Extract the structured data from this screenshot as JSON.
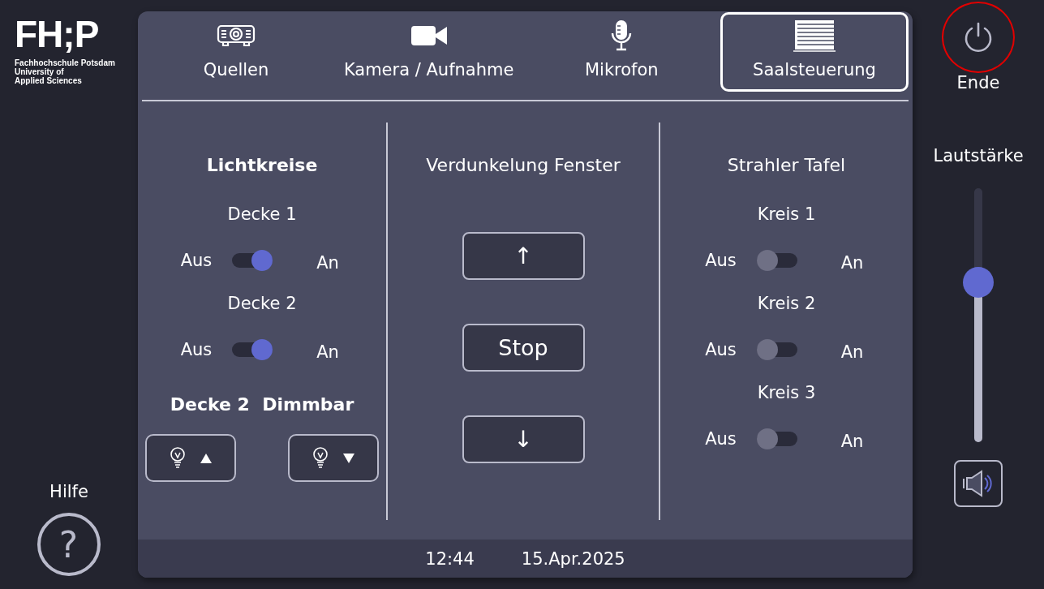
{
  "logo": {
    "wordmark": "FH;P",
    "lines": [
      "Fachhochschule Potsdam",
      "University of",
      "Applied Sciences"
    ]
  },
  "help": {
    "label": "Hilfe",
    "symbol": "?"
  },
  "tabs": [
    {
      "kind": "projector",
      "label": "Quellen",
      "selected": false
    },
    {
      "kind": "camera",
      "label": "Kamera / Aufnahme",
      "selected": false
    },
    {
      "kind": "microphone",
      "label": "Mikrofon",
      "selected": false
    },
    {
      "kind": "blinds",
      "label": "Saalsteuerung",
      "selected": true
    }
  ],
  "sections": [
    {
      "kind": "lights",
      "title": "Lichtkreise",
      "switches": [
        {
          "label": "Decke 1",
          "off_label": "Aus",
          "on_label": "An",
          "on": true
        },
        {
          "label": "Decke 2",
          "off_label": "Aus",
          "on_label": "An",
          "on": true
        }
      ],
      "dimmer": {
        "title": "Decke 2  Dimmbar",
        "buttons": [
          {
            "kind": "up"
          },
          {
            "kind": "down"
          }
        ]
      }
    },
    {
      "kind": "blinds",
      "title": "Verdunkelung Fenster",
      "buttons": [
        {
          "kind": "arrow",
          "label": "↑"
        },
        {
          "kind": "text",
          "label": "Stop"
        },
        {
          "kind": "arrow",
          "label": "↓"
        }
      ]
    },
    {
      "kind": "spots",
      "title": "Strahler Tafel",
      "switches": [
        {
          "label": "Kreis 1",
          "off_label": "Aus",
          "on_label": "An",
          "on": false
        },
        {
          "label": "Kreis 2",
          "off_label": "Aus",
          "on_label": "An",
          "on": false
        },
        {
          "label": "Kreis 3",
          "off_label": "Aus",
          "on_label": "An",
          "on": false
        }
      ]
    }
  ],
  "footer": {
    "time": "12:44",
    "date": "15.Apr.2025"
  },
  "power": {
    "label": "Ende",
    "highlighted": true
  },
  "volume": {
    "label": "Lautstärke",
    "level": 0.63
  }
}
